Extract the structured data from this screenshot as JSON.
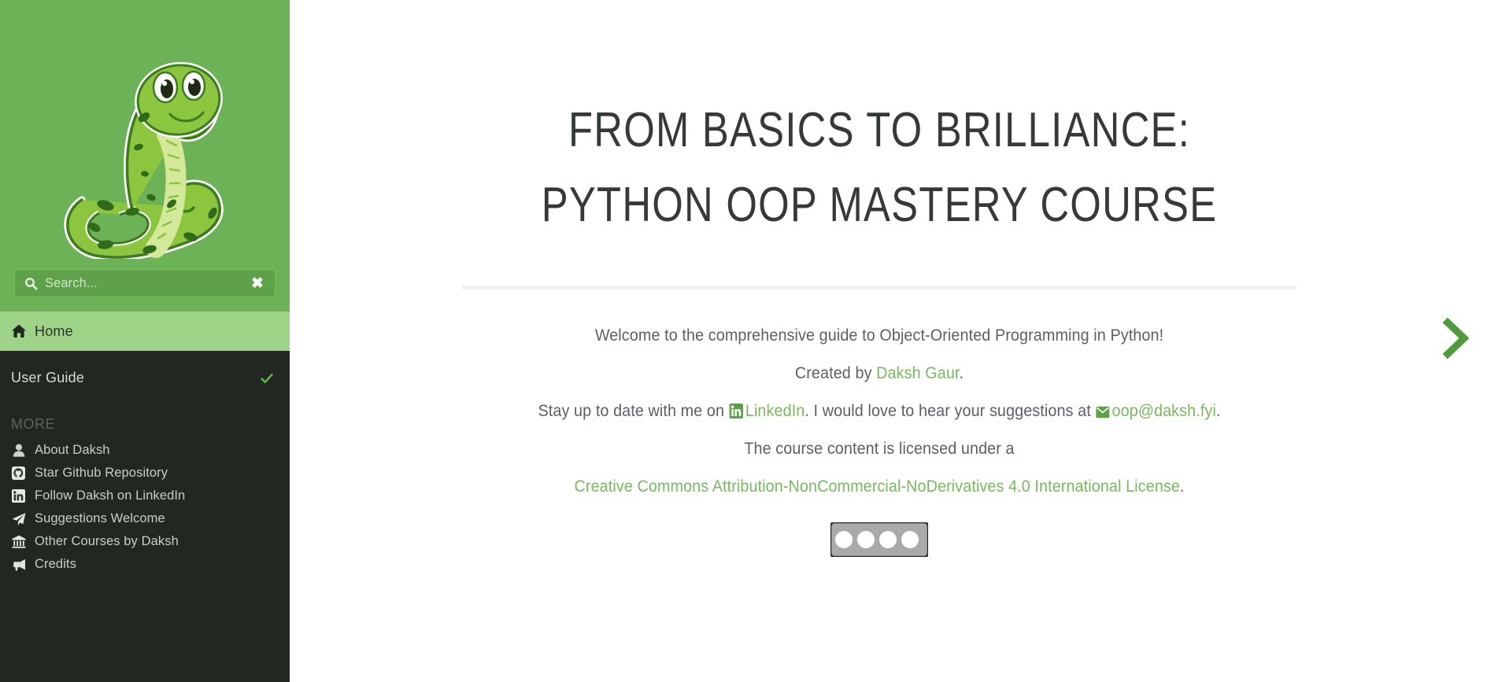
{
  "sidebar": {
    "logo": {
      "icon": "python-snake-logo",
      "alt": "Green cartoon snake mascot"
    },
    "search": {
      "icon": "search-icon",
      "placeholder": "Search...",
      "value": "",
      "clear_label": "✖",
      "clear_icon": "close-icon"
    },
    "active_nav": {
      "icon": "home-icon",
      "label": "Home"
    },
    "nav_items": [
      {
        "label": "User Guide",
        "icon": "check-icon",
        "expanded": true
      }
    ],
    "more_heading": "More",
    "more_items": [
      {
        "label": "About Daksh",
        "icon": "user-icon"
      },
      {
        "label": "Star Github Repository",
        "icon": "github-icon"
      },
      {
        "label": "Follow Daksh on LinkedIn",
        "icon": "linkedin-icon"
      },
      {
        "label": "Suggestions Welcome",
        "icon": "paper-plane-icon"
      },
      {
        "label": "Other Courses by Daksh",
        "icon": "bank-icon"
      },
      {
        "label": "Credits",
        "icon": "bullhorn-icon"
      }
    ],
    "colors": {
      "header_green": "#6cb257",
      "active_green": "#9ed488",
      "dark": "#222722",
      "search_bg": "#5ea14a"
    }
  },
  "main": {
    "title": "From Basics to Brilliance: Python OOP Mastery Course",
    "paragraphs": {
      "welcome": "Welcome to the comprehensive guide to Object-Oriented Programming in Python!",
      "created_prefix": "Created by ",
      "created_link": "Daksh Gaur",
      "created_suffix": ".",
      "stay_prefix": "Stay up to date with me on ",
      "linkedin_link": "LinkedIn",
      "stay_mid": ". I would love to hear your suggestions at ",
      "email_link": "oop@daksh.fyi",
      "stay_suffix": ".",
      "license_prefix": "The course content is licensed under a",
      "license_link": "Creative Commons Attribution-NonCommercial-NoDerivatives 4.0 International License",
      "license_suffix": "."
    },
    "cc_badge": {
      "icon": "creative-commons-badge",
      "alt": "CC BY-NC-ND badge"
    },
    "next_page": {
      "icon": "chevron-right-icon",
      "label": "Next"
    },
    "colors": {
      "link_green": "#7bb661",
      "heading": "#36393a",
      "body": "#5b6066",
      "rule": "#eff1f3"
    }
  }
}
